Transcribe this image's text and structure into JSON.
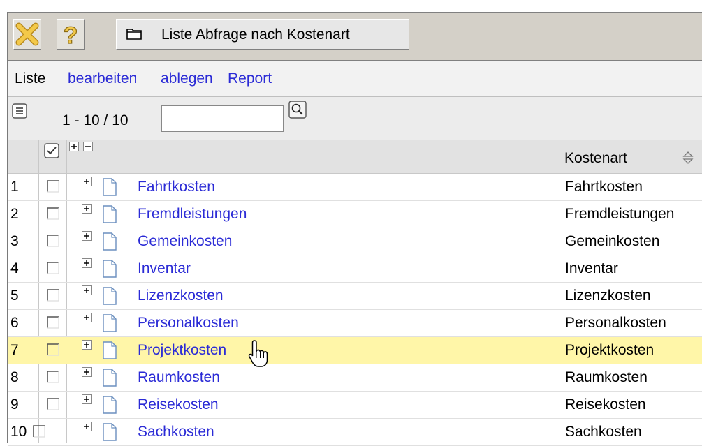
{
  "toolbar": {
    "close_icon": "close-x-icon",
    "help_icon": "help-question-icon",
    "list_button_label": "Liste Abfrage nach Kostenart",
    "list_button_icon": "folder-icon"
  },
  "menu": {
    "static_label": "Liste",
    "items": [
      "bearbeiten",
      "ablegen",
      "Report"
    ]
  },
  "pager": {
    "range_text": "1 - 10 / 10",
    "search_value": "",
    "search_icon": "magnifier-icon",
    "list_icon": "list-view-icon"
  },
  "table": {
    "column_header": "Kostenart",
    "sort_icon": "sort-updown-icon",
    "rows": [
      {
        "num": "1",
        "name": "Fahrtkosten",
        "kostenart": "Fahrtkosten"
      },
      {
        "num": "2",
        "name": "Fremdleistungen",
        "kostenart": "Fremdleistungen"
      },
      {
        "num": "3",
        "name": "Gemeinkosten",
        "kostenart": "Gemeinkosten"
      },
      {
        "num": "4",
        "name": "Inventar",
        "kostenart": "Inventar"
      },
      {
        "num": "5",
        "name": "Lizenzkosten",
        "kostenart": "Lizenzkosten"
      },
      {
        "num": "6",
        "name": "Personalkosten",
        "kostenart": "Personalkosten"
      },
      {
        "num": "7",
        "name": "Projektkosten",
        "kostenart": "Projektkosten"
      },
      {
        "num": "8",
        "name": "Raumkosten",
        "kostenart": "Raumkosten"
      },
      {
        "num": "9",
        "name": "Reisekosten",
        "kostenart": "Reisekosten"
      },
      {
        "num": "10",
        "name": "Sachkosten",
        "kostenart": "Sachkosten"
      }
    ]
  },
  "colors": {
    "link": "#2b2bd6",
    "highlight_row": "#fff6a8",
    "toolbar_bg": "#d4d0c8"
  }
}
